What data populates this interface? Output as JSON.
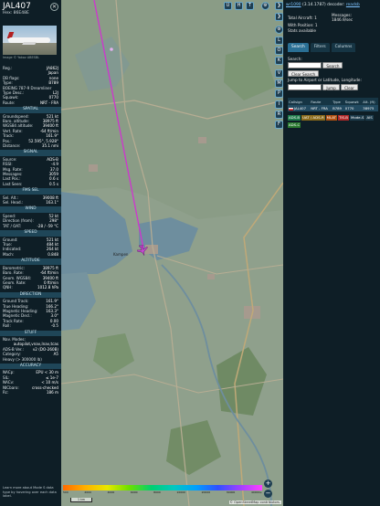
{
  "info": {
    "callsign": "JAL407",
    "hex_line": "Hex: 86E48E",
    "photo_caption": "Image © Yakov ABESBL",
    "rows_top": [
      {
        "k": "Reg.:",
        "v": "JA862J"
      },
      {
        "k": "",
        "v": "Japan"
      },
      {
        "k": "DB flags:",
        "v": "none"
      },
      {
        "k": "Type:",
        "v": "B789"
      },
      {
        "k": "BOEING 787-9 Dreamliner",
        "v": ""
      },
      {
        "k": "Type Desc.:",
        "v": "L2J"
      },
      {
        "k": "Squawk:",
        "v": "0770"
      },
      {
        "k": "Route:",
        "v": "NRT - FRA"
      }
    ],
    "sections": [
      {
        "title": "SPATIAL",
        "rows": [
          {
            "k": "Groundspeed:",
            "v": "521 kt"
          },
          {
            "k": "Baro. altitude:",
            "v": "38975 ft"
          },
          {
            "k": "WGS84 altitude:",
            "v": "39400 ft"
          },
          {
            "k": "Vert. Rate:",
            "v": "-64 ft/min"
          },
          {
            "k": "Track:",
            "v": "161.9°"
          },
          {
            "k": "Pos.:",
            "v": "52.595°, 5.928°"
          },
          {
            "k": "Distance:",
            "v": "35.1 nmi"
          }
        ]
      },
      {
        "title": "SIGNAL",
        "rows": [
          {
            "k": "Source:",
            "v": "ADS-B"
          },
          {
            "k": "RSSI:",
            "v": "-4.9"
          },
          {
            "k": "Msg. Rate:",
            "v": "37.0"
          },
          {
            "k": "Messages:",
            "v": "3059"
          },
          {
            "k": "Last Pos.:",
            "v": "0.6 s"
          },
          {
            "k": "Last Seen:",
            "v": "0.5 s"
          }
        ]
      },
      {
        "title": "FMS SEL",
        "rows": [
          {
            "k": "Sel. Alt.:",
            "v": "39008 ft"
          },
          {
            "k": "Sel. Head.:",
            "v": "163.1°"
          }
        ]
      },
      {
        "title": "WIND",
        "rows": [
          {
            "k": "Speed:",
            "v": "52 kt"
          },
          {
            "k": "Direction (from):",
            "v": "298°"
          },
          {
            "k": "TAT / OAT:",
            "v": "-28 / -59 °C"
          }
        ]
      },
      {
        "title": "SPEED",
        "rows": [
          {
            "k": "Ground:",
            "v": "521 kt"
          },
          {
            "k": "True:",
            "v": "484 kt"
          },
          {
            "k": "Indicated:",
            "v": "264 kt"
          },
          {
            "k": "Mach:",
            "v": "0.848"
          }
        ]
      },
      {
        "title": "ALTITUDE",
        "rows": [
          {
            "k": "Barometric:",
            "v": "38975 ft"
          },
          {
            "k": "Baro. Rate:",
            "v": "-64 ft/min"
          },
          {
            "k": "Geom. WGS84:",
            "v": "39400 ft"
          },
          {
            "k": "Geom. Rate:",
            "v": "0 ft/min"
          },
          {
            "k": "QNH:",
            "v": "1012.8 hPa"
          }
        ]
      },
      {
        "title": "DIRECTION",
        "rows": [
          {
            "k": "Ground Track:",
            "v": "161.9°"
          },
          {
            "k": "True Heading:",
            "v": "166.2°"
          },
          {
            "k": "Magnetic Heading:",
            "v": "163.3°"
          },
          {
            "k": "Magnetic Decl.:",
            "v": "3.0°"
          },
          {
            "k": "Track Rate:",
            "v": "0.00"
          },
          {
            "k": "Roll:",
            "v": "-0.5"
          }
        ]
      },
      {
        "title": "STUFF",
        "rows": [
          {
            "k": "Nav. Modes:",
            "v": ""
          },
          {
            "k": "",
            "v": "autopilot,vnav,lnav,tcas"
          },
          {
            "k": "ADS-B Ver.:",
            "v": "v2 (DO-260B)"
          },
          {
            "k": "Category:",
            "v": "A5"
          },
          {
            "k": "Heavy (> 300000 lb)",
            "v": ""
          }
        ]
      },
      {
        "title": "ACCURACY",
        "rows": [
          {
            "k": "NACp:",
            "v": "EPU < 30 m"
          },
          {
            "k": "SIL:",
            "v": "≤ 1e-7"
          },
          {
            "k": "NACv:",
            "v": "< 10 m/s"
          },
          {
            "k": "NICbaro:",
            "v": "cross-checked"
          },
          {
            "k": "Rc:",
            "v": "186 m"
          }
        ]
      }
    ],
    "footer": "Learn more about Mode S data type by hovering over each data label."
  },
  "map": {
    "top_buttons": [
      "U",
      "H",
      "T"
    ],
    "legend_labels": [
      "500",
      "2000",
      "4000",
      "6000",
      "8000",
      "10000",
      "20000",
      "30000",
      "40000+"
    ],
    "scale": "1 km",
    "attribution": "© OpenStreetMap contributors.",
    "zoom_in": "+",
    "zoom_out": "−",
    "place_label": "Kampen",
    "track_color": "#d033d0",
    "label_color": "#e3b0f0"
  },
  "toolbar": {
    "buttons": [
      "L",
      "O",
      "K",
      "V",
      "M",
      "P",
      "I",
      "R",
      "F"
    ],
    "arrows": [
      "❯",
      "❯"
    ]
  },
  "right": {
    "header_text": "(3.14.1787) decoder:",
    "header_link": "wr1090",
    "header_link2": "readsb",
    "stats": {
      "total_label": "Total Aircraft:",
      "total_value": "1",
      "messages_label": "Messages:",
      "messages_value": "1846.9/sec",
      "withpos_label": "With Position:",
      "withpos_value": "1",
      "stats_label": "Stats available"
    },
    "tabs": [
      "Search",
      "Filters",
      "Columns"
    ],
    "search": {
      "label": "Search:",
      "search_button": "Search",
      "clear_button": "Clear Search",
      "jump_label": "Jump to Airport or Latitude, Longitude:",
      "jump_button": "Jump",
      "clear2_button": "Clear"
    },
    "table": {
      "headers": [
        "Callsign",
        "Route",
        "Type",
        "Squawk",
        "Alt. (ft)"
      ],
      "rows": [
        {
          "callsign": "JAL407",
          "route": "NRT - FRA",
          "type": "B789",
          "squawk": "0770",
          "alt": "38975"
        }
      ]
    },
    "source_chips": [
      {
        "label": "ADS-B",
        "color": "#1f7a4a"
      },
      {
        "label": "UAT / ADS-R",
        "color": "#8a6a1a"
      },
      {
        "label": "MLAT",
        "color": "#b05010"
      },
      {
        "label": "TIS-B",
        "color": "#b02828"
      },
      {
        "label": "Mode-S",
        "color": "#1c3a4a"
      },
      {
        "label": "AIS",
        "color": "#1c3a4a"
      },
      {
        "label": "ADS-C",
        "color": "#2a7a30"
      }
    ]
  }
}
